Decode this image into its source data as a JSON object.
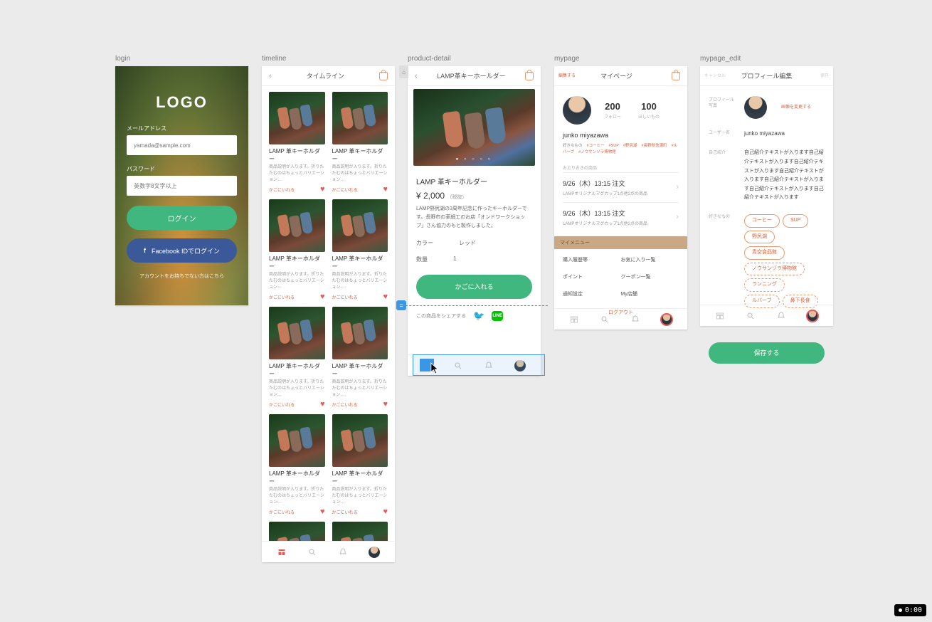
{
  "labels": {
    "login": "login",
    "timeline": "timeline",
    "product_detail": "product-detail",
    "mypage": "mypage",
    "mypage_edit": "mypage_edit"
  },
  "login": {
    "logo": "LOGO",
    "email_label": "メールアドレス",
    "email_placeholder": "yamada@sample.com",
    "password_label": "パスワード",
    "password_placeholder": "英数字8文字以上",
    "login_btn": "ログイン",
    "fb_btn": "Facebook IDでログイン",
    "footer": "アカウントをお持ちでない方はこちら"
  },
  "timeline": {
    "title": "タイムライン",
    "card_title": "LAMP 革キーホルダー",
    "card_desc": "商品説明が入ります。折りたたむのはちょっとバリエーション…",
    "card_link": "かごにいれる"
  },
  "product": {
    "title": "LAMP革キーホールダー",
    "name": "LAMP 革キーホルダー",
    "price": "¥ 2,000",
    "tax": "（税抜）",
    "desc": "LAMP野尻湖の3周年記念に作ったキーホルダーです。長野市の革細工のお店「オンドワークショップ」さん協力のもと製作しました。",
    "color_label": "カラー",
    "color_value": "レッド",
    "qty_label": "数量",
    "qty_value": "1",
    "cart_btn": "かごに入れる",
    "share_label": "この商品をシェアする",
    "line": "LINE"
  },
  "mypage": {
    "edit_link": "編集する",
    "title": "マイページ",
    "stat1_num": "200",
    "stat1_lbl": "フォロー",
    "stat2_num": "100",
    "stat2_lbl": "ほしいもの",
    "name": "junko miyazawa",
    "tag_lbl": "好きなもの",
    "tags": [
      "#コーヒー",
      "#SUP",
      "#野尻湖",
      "#長野県信濃町",
      "#ルバーブ",
      "#ノウサンゾラ博物館"
    ],
    "order_head": "おとりおきの商品",
    "order1_t": "9/26（木）13:15 注文",
    "order1_s": "LAMPオリジナルマグカップ1点他2点の商品",
    "order2_t": "9/26（木）13:15 注文",
    "order2_s": "LAMPオリジナルマグカップ1点他2点の商品",
    "menu_bar": "マイメニュー",
    "link1": "購入履歴等",
    "link2": "お気に入り一覧",
    "link3": "ポイント",
    "link4": "クーポン一覧",
    "link5": "通知設定",
    "link6": "My店舗",
    "logout": "ログアウト"
  },
  "mypage_edit": {
    "cancel": "キャンセル",
    "title": "プロフィール編集",
    "save_top": "保存",
    "row_photo_lbl": "プロフィール写真",
    "row_photo_link": "画像を変更する",
    "row_name_lbl": "ユーザー名",
    "row_name_val": "junko miyazawa",
    "row_bio_lbl": "自己紹介",
    "row_bio_val": "自己紹介テキストが入ります自己紹介テキストが入ります自己紹介テキストが入ります自己紹介テキストが入ります自己紹介テキストが入ります自己紹介テキストが入ります自己紹介テキストが入ります",
    "row_tag_lbl": "好きなもの",
    "pillsA": [
      "コーヒー",
      "SUP",
      "野尻湖"
    ],
    "pillsA2": [
      "青空食品館"
    ],
    "pillsB": [
      "ノウサンゾラ博物館"
    ],
    "pillsC": [
      "ランニング",
      "ルバーブ",
      "鼻下長食"
    ],
    "save_btn": "保存する"
  },
  "timer": "0:00"
}
